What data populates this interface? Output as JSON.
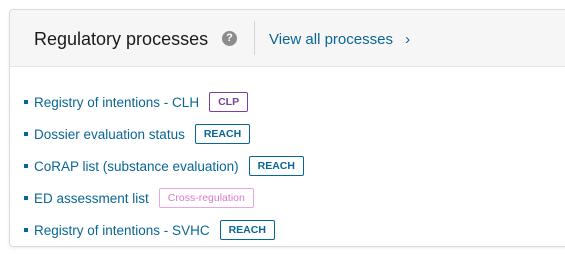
{
  "header": {
    "title": "Regulatory processes",
    "help_icon": "help-icon",
    "help_glyph": "?",
    "view_all_label": "View all processes",
    "chevron_glyph": "›"
  },
  "colors": {
    "link": "#0a6694",
    "clp_tag": "#7a3f9d",
    "reach_tag": "#0a6694",
    "cross_tag": "#d979cc"
  },
  "items": [
    {
      "label": "Registry of intentions - CLH",
      "tag": "CLP"
    },
    {
      "label": "Dossier evaluation status",
      "tag": "REACH"
    },
    {
      "label": "CoRAP list (substance evaluation)",
      "tag": "REACH"
    },
    {
      "label": "ED assessment list",
      "tag": "Cross-regulation"
    },
    {
      "label": "Registry of intentions - SVHC",
      "tag": "REACH"
    }
  ]
}
